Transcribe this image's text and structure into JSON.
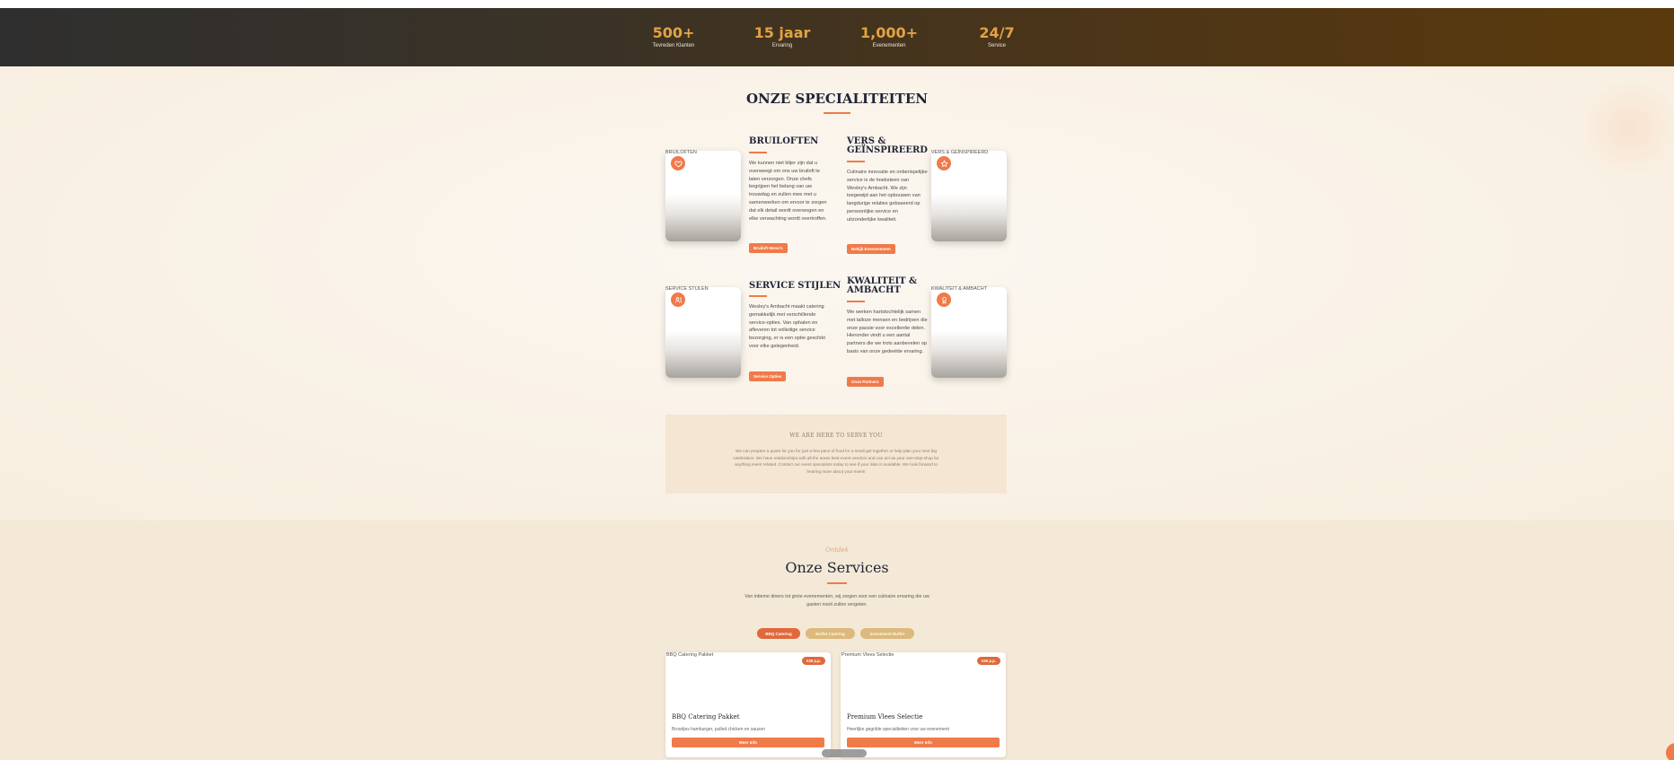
{
  "stats": [
    {
      "value": "500+",
      "label": "Tevreden Klanten"
    },
    {
      "value": "15 jaar",
      "label": "Ervaring"
    },
    {
      "value": "1,000+",
      "label": "Evenementen"
    },
    {
      "value": "24/7",
      "label": "Service"
    }
  ],
  "specialties": {
    "title": "ONZE SPECIALITEITEN",
    "items": [
      {
        "heading": "BRUILOFTEN",
        "image_alt": "BRUILOFTEN",
        "icon": "heart-icon",
        "body": "We kunnen niet blijer zijn dat u overweegt om ons uw bruiloft te laten verzorgen. Onze chefs begrijpen het belang van uw trouwdag en zullen mee met u samenwerken om ervoor te zorgen dat elk detail wordt overwogen en elke verwachting wordt overtroffen.",
        "button": "Bruiloft Menu's"
      },
      {
        "heading": "VERS & GEÏNSPIREERD",
        "image_alt": "VERS & GEÏNSPIREERD",
        "icon": "star-icon",
        "body": "Culinaire innovatie en onberispelijke service is de hoeksteen van Wesley's Ambacht. We zijn toegewijd aan het opbouwen van langdurige relaties gebaseerd op persoonlijke service en uitzonderlijke kwaliteit.",
        "button": "Bekijk Evenementen"
      },
      {
        "heading": "SERVICE STIJLEN",
        "image_alt": "SERVICE STIJLEN",
        "icon": "users-icon",
        "body": "Wesley's Ambacht maakt catering gemakkelijk met verschillende service-opties. Van ophalen en afleveren tot volledige service bezorging, er is een optie geschikt voor elke gelegenheid.",
        "button": "Service Opties"
      },
      {
        "heading": "KWALITEIT & AMBACHT",
        "image_alt": "KWALITEIT & AMBACHT",
        "icon": "award-icon",
        "body": "We werken hartstochtelijk samen met talloze mensen en bedrijven die onze passie voor excellentie delen. Hieronder vindt u een aantal partners die we trots aanbevelen op basis van onze gedeelde ervaring.",
        "button": "Onze Partners"
      }
    ],
    "serve_box": {
      "title": "WE ARE HERE TO SERVE YOU",
      "text": "We can prepare a quote for you for just a few pans of food for a small get together or help plan your next big celebration. We have relationships with all the areas best event vendors and can act as your one-stop-shop for anything event related. Contact our event specialists today to see if your date is available. We look forward to hearing more about your event!"
    }
  },
  "services": {
    "script": "Ontdek",
    "title": "Onze Services",
    "subtitle": "Van intieme diners tot grote evenementen, wij zorgen voor een culinaire ervaring die uw gasten nooit zullen vergeten.",
    "tabs": [
      {
        "label": "BBQ Catering",
        "active": true
      },
      {
        "label": "Buffet Catering",
        "active": false
      },
      {
        "label": "Evenement Buffet",
        "active": false
      }
    ],
    "packages": [
      {
        "image_alt": "BBQ Catering Pakket",
        "price": "€35 p.p.",
        "name": "BBQ Catering Pakket",
        "description": "Broodjes hamburger, pulled chicken en sauzen",
        "button": "Meer Info"
      },
      {
        "image_alt": "Premium Vlees Selectie",
        "price": "€45 p.p.",
        "name": "Premium Vlees Selectie",
        "description": "Heerlijke gegrilde specialiteiten voor uw evenement",
        "button": "Meer Info"
      }
    ]
  },
  "colors": {
    "accent": "#ef7a4a",
    "stat_number": "#e3a243",
    "navy": "#1f2437",
    "services_bg": "#f4e9d6"
  }
}
